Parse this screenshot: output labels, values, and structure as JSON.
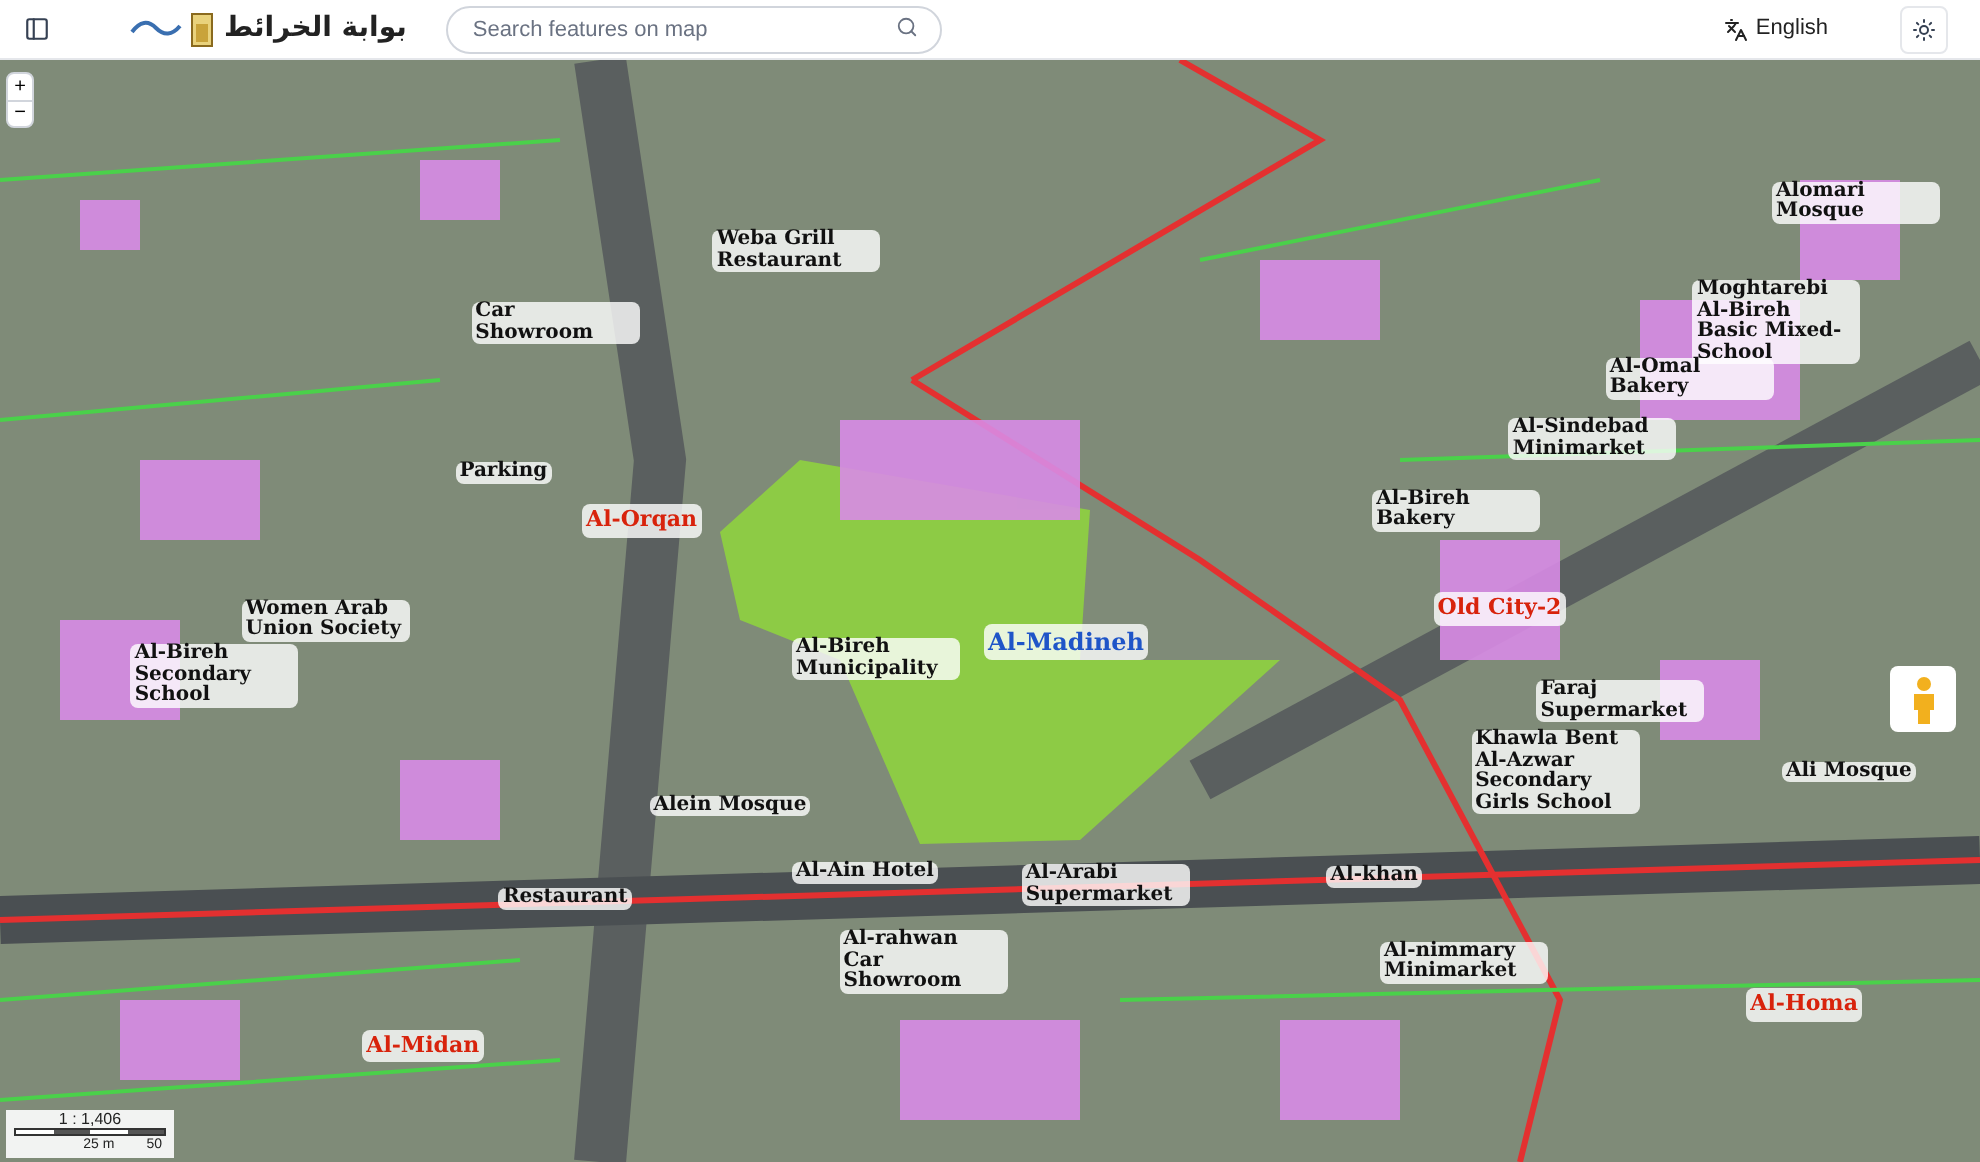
{
  "header": {
    "title": "بوابة الخرائط",
    "search": {
      "placeholder": "Search features on map"
    },
    "language": "English"
  },
  "map": {
    "zoom_in": "+",
    "zoom_out": "−",
    "labels": [
      {
        "kind": "poi",
        "text": "Alomari Mosque"
      },
      {
        "kind": "poi",
        "text": "Weba Grill Restaurant"
      },
      {
        "kind": "poi",
        "text": "Car Showroom"
      },
      {
        "kind": "poi",
        "text": "Moghtarebi Al-Bireh Basic Mixed-School"
      },
      {
        "kind": "poi",
        "text": "Al-Omal Bakery"
      },
      {
        "kind": "poi",
        "text": "Al-Sindebad Minimarket"
      },
      {
        "kind": "poi",
        "text": "Parking"
      },
      {
        "kind": "area",
        "text": "Al-Orqan"
      },
      {
        "kind": "poi",
        "text": "Al-Bireh Bakery"
      },
      {
        "kind": "area",
        "text": "Old City-2"
      },
      {
        "kind": "poi",
        "text": "Women Arab Union Society"
      },
      {
        "kind": "poi",
        "text": "Al-Bireh Secondary School"
      },
      {
        "kind": "poi",
        "text": "Al-Bireh Municipality"
      },
      {
        "kind": "district",
        "text": "Al-Madineh"
      },
      {
        "kind": "poi",
        "text": "Faraj Supermarket"
      },
      {
        "kind": "poi",
        "text": "Khawla Bent Al-Azwar Secondary Girls School"
      },
      {
        "kind": "poi",
        "text": "Ali Mosque"
      },
      {
        "kind": "poi",
        "text": "Alein Mosque"
      },
      {
        "kind": "poi",
        "text": "Restaurant"
      },
      {
        "kind": "poi",
        "text": "Al-Ain Hotel"
      },
      {
        "kind": "poi",
        "text": "Al-Arabi Supermarket"
      },
      {
        "kind": "poi",
        "text": "Al-khan"
      },
      {
        "kind": "poi",
        "text": "Al-rahwan Car Showroom"
      },
      {
        "kind": "poi",
        "text": "Al-nimmary Minimarket"
      },
      {
        "kind": "area",
        "text": "Al-Midan"
      },
      {
        "kind": "area",
        "text": "Al-Homa"
      }
    ],
    "scale": {
      "ratio": "1 : 1,406",
      "mid": "25 m",
      "end": "50"
    }
  }
}
